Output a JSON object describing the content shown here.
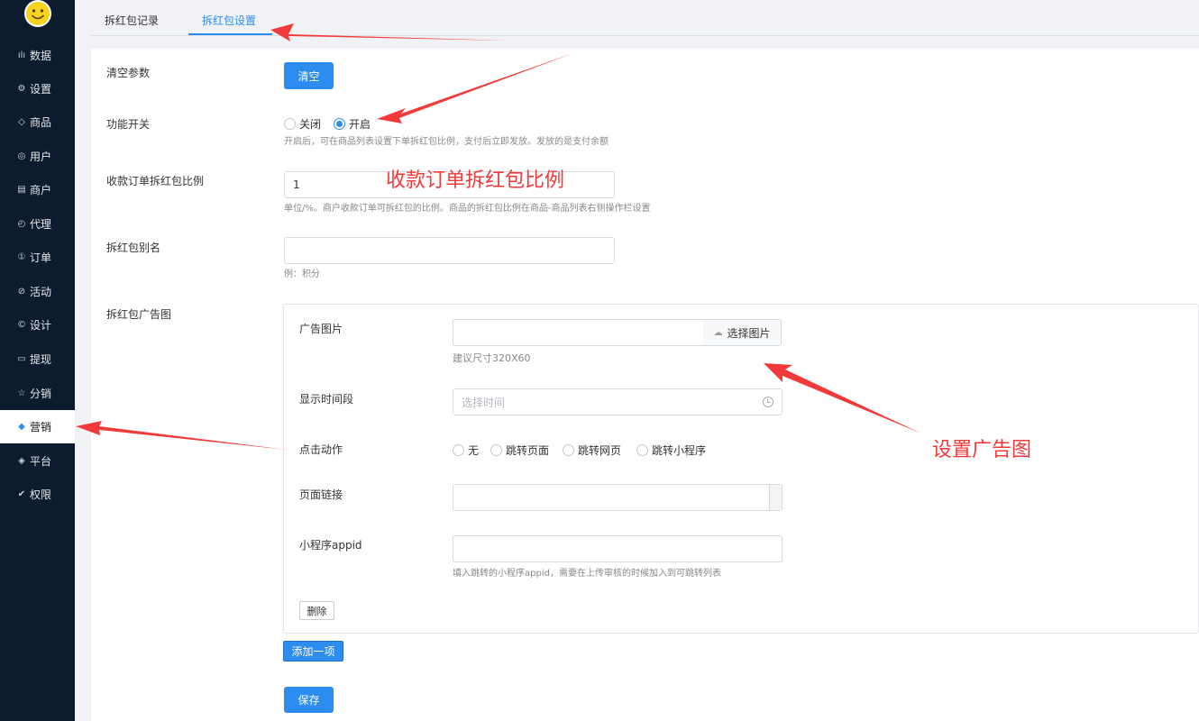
{
  "sidebar": {
    "items": [
      {
        "label": "数据",
        "icon": "chart-icon",
        "glyph": "ılı"
      },
      {
        "label": "设置",
        "icon": "gear-icon",
        "glyph": "⚙"
      },
      {
        "label": "商品",
        "icon": "box-icon",
        "glyph": "◇"
      },
      {
        "label": "用户",
        "icon": "user-icon",
        "glyph": "◎"
      },
      {
        "label": "商户",
        "icon": "store-icon",
        "glyph": "▤"
      },
      {
        "label": "代理",
        "icon": "agent-icon",
        "glyph": "◴"
      },
      {
        "label": "订单",
        "icon": "order-icon",
        "glyph": "①"
      },
      {
        "label": "活动",
        "icon": "tag-icon",
        "glyph": "⊘"
      },
      {
        "label": "设计",
        "icon": "design-icon",
        "glyph": "©"
      },
      {
        "label": "提现",
        "icon": "card-icon",
        "glyph": "▭"
      },
      {
        "label": "分销",
        "icon": "star-icon",
        "glyph": "☆"
      },
      {
        "label": "营销",
        "icon": "cube-icon",
        "glyph": "◆"
      },
      {
        "label": "平台",
        "icon": "platform-icon",
        "glyph": "◈"
      },
      {
        "label": "权限",
        "icon": "shield-check-icon",
        "glyph": "✔"
      }
    ],
    "active": "营销"
  },
  "tabs": [
    {
      "label": "拆红包记录"
    },
    {
      "label": "拆红包设置"
    }
  ],
  "form": {
    "clear": {
      "label": "清空参数",
      "button": "清空"
    },
    "switch": {
      "label": "功能开关",
      "options": [
        "关闭",
        "开启"
      ],
      "selected": "开启",
      "hint": "开启后，可在商品列表设置下单拆红包比例，支付后立即发放。发放的是支付余额"
    },
    "ratio": {
      "label": "收款订单拆红包比例",
      "value": "1",
      "hint": "单位/%。商户收款订单可拆红包的比例。商品的拆红包比例在商品-商品列表右侧操作栏设置"
    },
    "alias": {
      "label": "拆红包别名",
      "value": "",
      "hint": "例：积分"
    },
    "ad": {
      "label": "拆红包广告图",
      "image_label": "广告图片",
      "image_button": "选择图片",
      "image_hint": "建议尺寸320X60",
      "time_label": "显示时间段",
      "time_placeholder": "选择时间",
      "action_label": "点击动作",
      "action_options": [
        "无",
        "跳转页面",
        "跳转网页",
        "跳转小程序"
      ],
      "link_label": "页面链接",
      "appid_label": "小程序appid",
      "appid_hint": "填入跳转的小程序appid，需要在上传审核的时候加入到可跳转列表",
      "delete_button": "删除"
    },
    "add_button": "添加一项",
    "save_button": "保存"
  },
  "annotations": {
    "ratio": "收款订单拆红包比例",
    "ad": "设置广告图",
    "color": "#f23a3a"
  },
  "colors": {
    "primary": "#2d8cf0",
    "sidebar": "#0d1b2e"
  }
}
